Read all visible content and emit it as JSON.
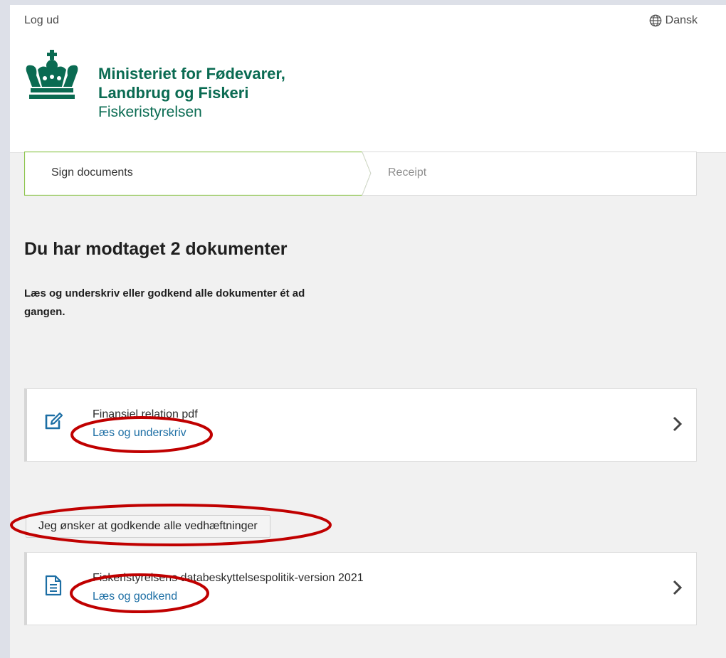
{
  "header": {
    "logout_label": "Log ud",
    "language_label": "Dansk",
    "ministry_line1": "Ministeriet for Fødevarer,",
    "ministry_line2": "Landbrug og Fiskeri",
    "agency": "Fiskeristyrelsen",
    "brand_color": "#0a6b52"
  },
  "steps": [
    {
      "label": "Sign documents",
      "active": true
    },
    {
      "label": "Receipt",
      "active": false
    }
  ],
  "main": {
    "title": "Du har modtaget 2 dokumenter",
    "intro": "Læs og underskriv eller godkend alle dokumenter ét ad gangen.",
    "approve_all_label": "Jeg ønsker at godkende alle vedhæftninger",
    "documents": [
      {
        "name": "Finansiel relation pdf",
        "action": "Læs og underskriv",
        "icon": "edit-document-icon"
      },
      {
        "name": "Fiskeristyrelsens databeskyttelsespolitik-version 2021",
        "action": "Læs og godkend",
        "icon": "document-icon"
      }
    ]
  },
  "colors": {
    "link": "#1c6ea4",
    "annotation": "#c00000",
    "step_active_border": "#7cb342"
  }
}
